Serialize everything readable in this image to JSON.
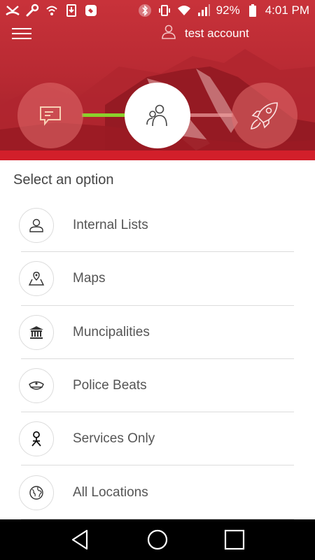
{
  "status_bar": {
    "left_icons": [
      "missed-call-icon",
      "wrench-icon",
      "wifi-calling-icon",
      "download-icon",
      "app-notification-icon"
    ],
    "right_icons": [
      "bluetooth-icon",
      "vibrate-icon",
      "wifi-icon",
      "signal-icon",
      "battery-icon"
    ],
    "battery": "92%",
    "time": "4:01 PM"
  },
  "header": {
    "menu_icon": "hamburger-menu-icon",
    "account_icon": "user-icon",
    "account_name": "test account"
  },
  "progress": {
    "steps": [
      {
        "icon": "chat-icon",
        "state": "done"
      },
      {
        "icon": "people-icon",
        "state": "active"
      },
      {
        "icon": "rocket-icon",
        "state": "pending"
      }
    ],
    "colors": {
      "done_connector": "#8bd12c",
      "active": "#ffffff",
      "hero": "#c8323a"
    }
  },
  "main": {
    "section_title": "Select an option",
    "options": [
      {
        "label": "Internal Lists",
        "icon": "person-icon"
      },
      {
        "label": "Maps",
        "icon": "map-pin-icon"
      },
      {
        "label": "Muncipalities",
        "icon": "government-building-icon"
      },
      {
        "label": "Police Beats",
        "icon": "police-cap-icon"
      },
      {
        "label": "Services Only",
        "icon": "services-figure-icon"
      },
      {
        "label": "All Locations",
        "icon": "globe-icon"
      }
    ]
  },
  "nav": {
    "buttons": [
      "back-icon",
      "home-icon",
      "recents-icon"
    ]
  }
}
